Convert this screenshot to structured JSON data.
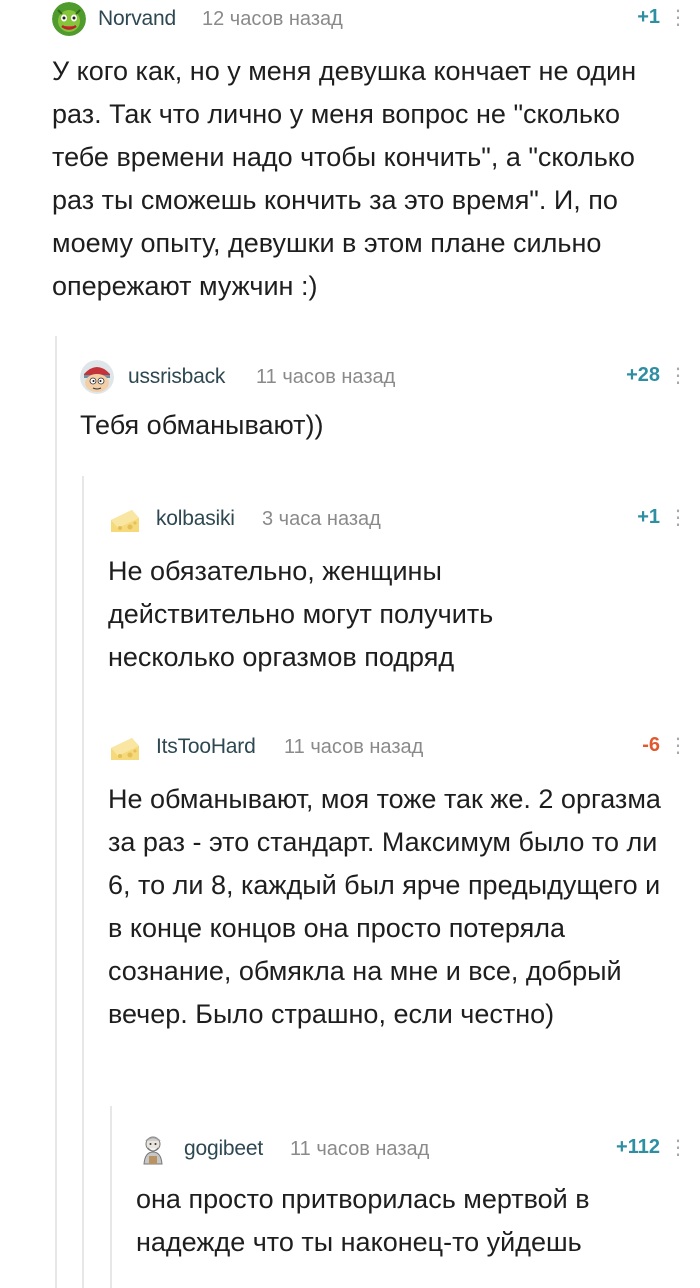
{
  "comments": [
    {
      "username": "Norvand",
      "time": "12 часов назад",
      "rating": "+1",
      "more_glyph": "⋮",
      "avatar_icon": "green-monster-avatar",
      "text": "У кого как, но у меня девушка кончает не один раз. Так что лично у меня вопрос не \"сколько тебе времени надо чтобы кончить\", а \"сколько раз ты сможешь кончить за это время\". И, по моему опыту, девушки в этом плане сильно опережают мужчин :)"
    },
    {
      "username": "ussrisback",
      "time": "11 часов назад",
      "rating": "+28",
      "more_glyph": "⋮",
      "avatar_icon": "cartoon-character-avatar",
      "text": "Тебя обманывают))"
    },
    {
      "username": "kolbasiki",
      "time": "3 часа назад",
      "rating": "+1",
      "more_glyph": "⋮",
      "avatar_icon": "cheese-avatar",
      "text": "Не обязательно, женщины действительно могут получить несколько оргазмов подряд"
    },
    {
      "username": "ItsTooHard",
      "time": "11 часов назад",
      "rating": "-6",
      "more_glyph": "⋮",
      "avatar_icon": "cheese-avatar",
      "text": "Не обманывают, моя тоже так же. 2 оргазма за раз - это стандарт. Максимум было то ли 6, то ли 8, каждый был ярче предыдущего и в конце концов она просто потеряла сознание, обмякла на мне и все, добрый вечер. Было страшно, если честно)"
    },
    {
      "username": "gogibeet",
      "time": "11 часов назад",
      "rating": "+112",
      "more_glyph": "⋮",
      "avatar_icon": "old-man-avatar",
      "text": "она  просто притворилась мертвой в надежде что ты наконец-то уйдешь"
    }
  ],
  "colors": {
    "rating_positive": "#2e8fa3",
    "rating_negative": "#e05a2e",
    "username": "#2e4852",
    "branch_line": "#e7e7e7"
  }
}
